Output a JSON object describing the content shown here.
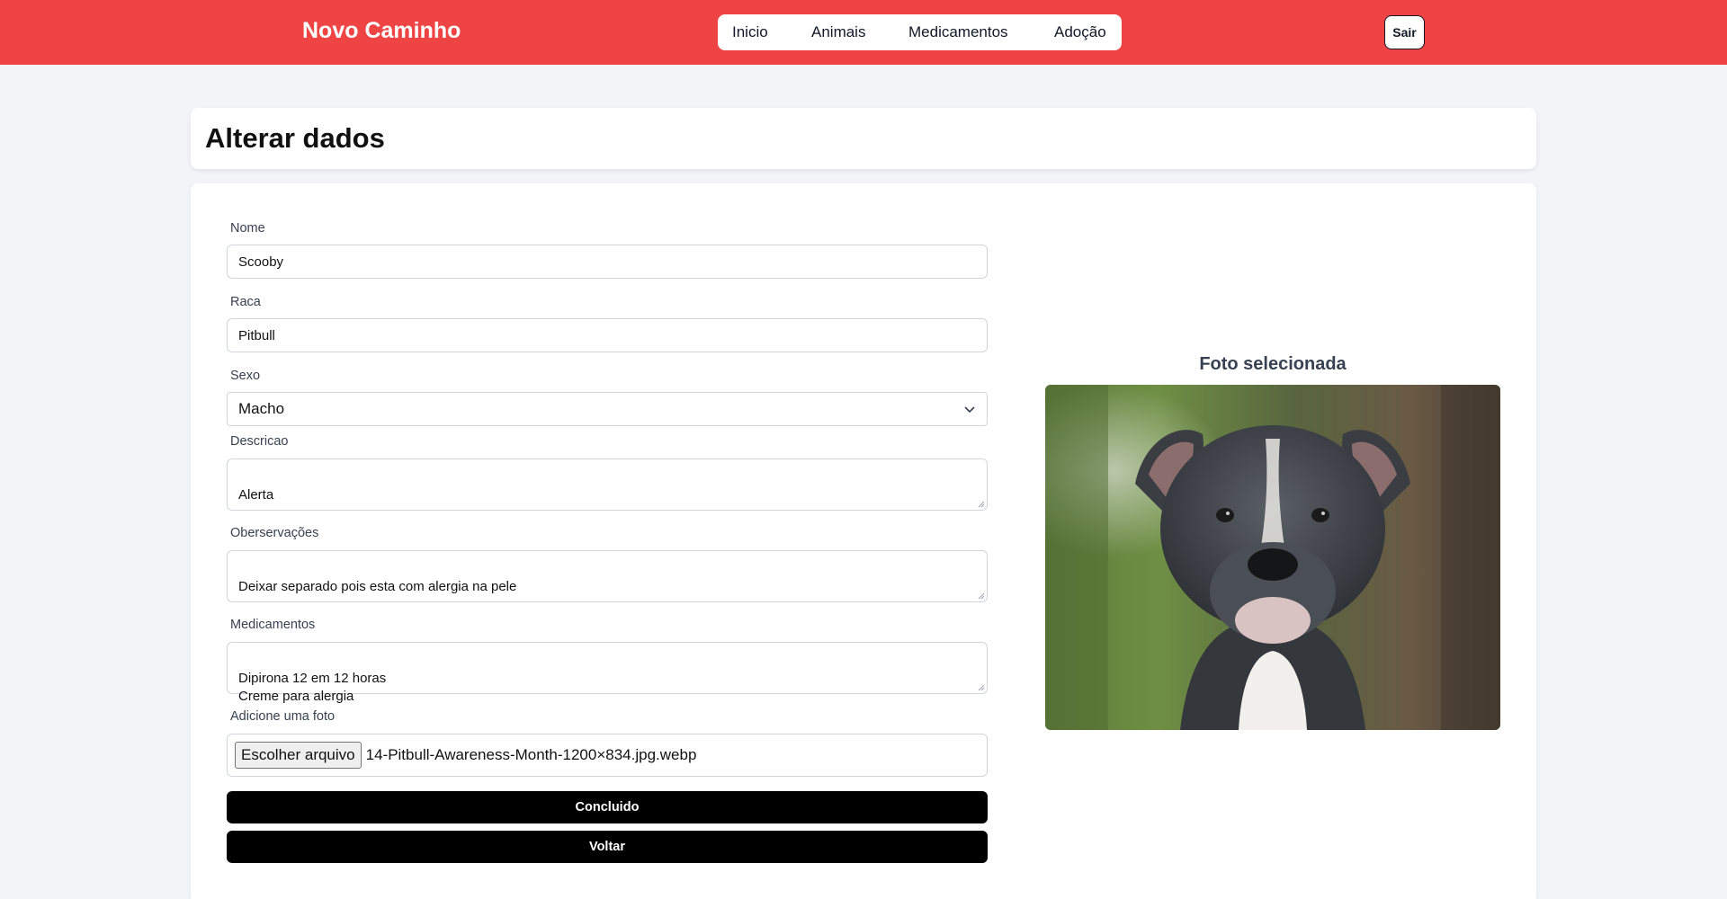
{
  "nav": {
    "brand": "Novo Caminho",
    "items": [
      "Inicio",
      "Animais",
      "Medicamentos",
      "Adoção"
    ],
    "logout": "Sair"
  },
  "page": {
    "title": "Alterar dados"
  },
  "form": {
    "nome": {
      "label": "Nome",
      "value": "Scooby"
    },
    "raca": {
      "label": "Raca",
      "value": "Pitbull"
    },
    "sexo": {
      "label": "Sexo",
      "value": "Macho"
    },
    "descricao": {
      "label": "Descricao",
      "value": "Alerta"
    },
    "observacoes": {
      "label": "Oberservações",
      "value": "Deixar separado pois esta com alergia na pele"
    },
    "medicamentos": {
      "label": "Medicamentos",
      "value": "Dipirona 12 em 12 horas\nCreme para alergia"
    },
    "foto": {
      "label": "Adicione uma foto",
      "button": "Escolher arquivo",
      "filename": "14-Pitbull-Awareness-Month-1200×834.jpg.webp"
    },
    "submit": "Concluido",
    "back": "Voltar"
  },
  "preview": {
    "title": "Foto selecionada"
  },
  "colors": {
    "navbar": "#ef4444",
    "background": "#f3f4f6",
    "button": "#000000"
  }
}
